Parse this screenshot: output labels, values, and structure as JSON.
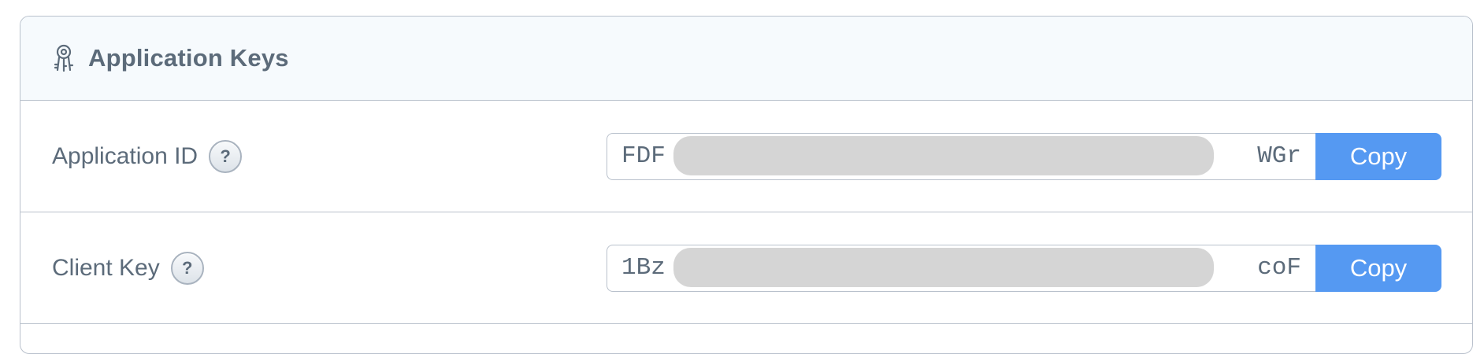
{
  "panel": {
    "title": "Application Keys",
    "icon": "keys-icon"
  },
  "rows": [
    {
      "label": "Application ID",
      "help_icon_text": "?",
      "key_visible_start": "FDF",
      "key_visible_end": "WGr",
      "copy_label": "Copy"
    },
    {
      "label": "Client Key",
      "help_icon_text": "?",
      "key_visible_start": "1Bz",
      "key_visible_end": "coF",
      "copy_label": "Copy"
    }
  ],
  "colors": {
    "accent": "#5599f2",
    "text": "#5c6b7a",
    "border": "#b9c1cc",
    "header_bg": "#f6fafd",
    "redaction": "#d5d5d5"
  }
}
